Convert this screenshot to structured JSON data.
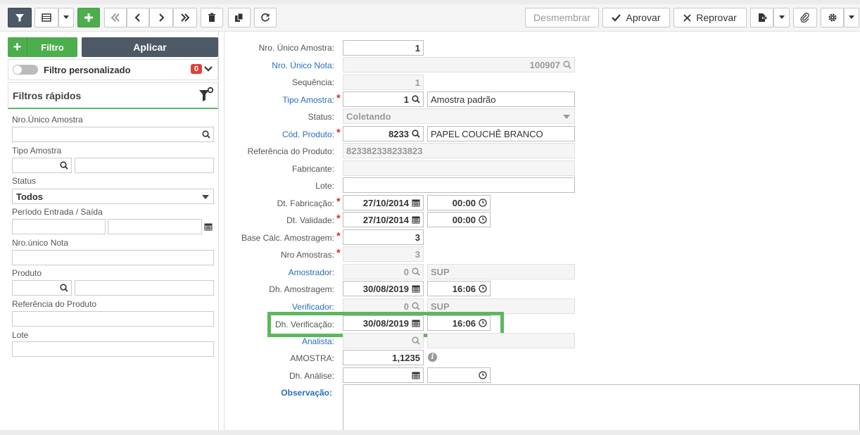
{
  "toolbar": {
    "desmembrar": "Desmembrar",
    "aprovar": "Aprovar",
    "reprovar": "Reprovar"
  },
  "left": {
    "filtro_label": "Filtro",
    "aplicar_label": "Aplicar",
    "filtro_personalizado": "Filtro personalizado",
    "badge_count": "0",
    "filtros_rapidos": "Filtros rápidos",
    "fields": {
      "nro_unico_amostra": "Nro.Único Amostra",
      "tipo_amostra": "Tipo Amostra",
      "status": "Status",
      "status_value": "Todos",
      "periodo": "Período Entrada / Saída",
      "nro_unico_nota": "Nro.único Nota",
      "produto": "Produto",
      "referencia": "Referência do Produto",
      "lote": "Lote"
    }
  },
  "form": {
    "labels": {
      "nro_unico_amostra": "Nro. Único Amostra:",
      "nro_unico_nota": "Nro. Único Nota:",
      "sequencia": "Sequência:",
      "tipo_amostra": "Tipo Amostra:",
      "status": "Status:",
      "cod_produto": "Cód. Produto:",
      "referencia": "Referência do Produto:",
      "fabricante": "Fabricante:",
      "lote": "Lote:",
      "dt_fabricacao": "Dt. Fabricação:",
      "dt_validade": "Dt. Validade:",
      "base_calc": "Base Cálc. Amostragem:",
      "nro_amostras": "Nro Amostras:",
      "amostrador": "Amostrador:",
      "dh_amostragem": "Dh. Amostragem:",
      "verificador": "Verificador:",
      "dh_verificacao": "Dh. Verificação:",
      "analista": "Analista:",
      "amostra": "AMOSTRA:",
      "dh_analise": "Dh. Análise:",
      "observacao": "Observação:"
    },
    "values": {
      "nro_unico_amostra": "1",
      "nro_unico_nota": "100907",
      "sequencia": "1",
      "tipo_amostra_code": "1",
      "tipo_amostra_desc": "Amostra padrão",
      "status": "Coletando",
      "cod_produto": "8233",
      "produto_desc": "PAPEL COUCHÊ BRANCO",
      "referencia": "823382338233823",
      "fabricante": "",
      "lote": "",
      "dt_fabricacao_date": "27/10/2014",
      "dt_fabricacao_time": "00:00",
      "dt_validade_date": "27/10/2014",
      "dt_validade_time": "00:00",
      "base_calc": "3",
      "nro_amostras": "3",
      "amostrador_code": "0",
      "amostrador_desc": "SUP",
      "dh_amostragem_date": "30/08/2019",
      "dh_amostragem_time": "16:06",
      "verificador_code": "0",
      "verificador_desc": "SUP",
      "dh_verificacao_date": "30/08/2019",
      "dh_verificacao_time": "16:06",
      "analista_code": "",
      "analista_desc": "",
      "amostra": "1,1235",
      "dh_analise_date": "",
      "dh_analise_time": ""
    }
  }
}
